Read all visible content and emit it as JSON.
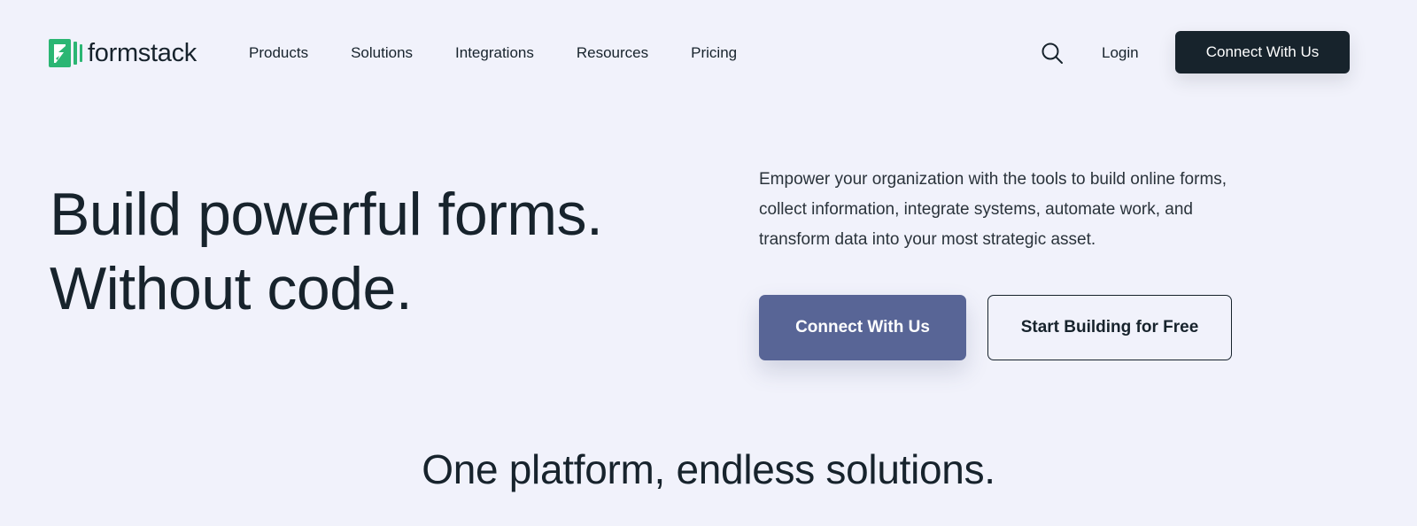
{
  "header": {
    "logo": {
      "text": "formstack",
      "icon": "formstack-logo-icon",
      "brand_color": "#2bb673"
    },
    "nav": [
      {
        "label": "Products"
      },
      {
        "label": "Solutions"
      },
      {
        "label": "Integrations"
      },
      {
        "label": "Resources"
      },
      {
        "label": "Pricing"
      }
    ],
    "search_icon": "search-icon",
    "login_label": "Login",
    "cta_label": "Connect With Us",
    "cta_color": "#17232c"
  },
  "hero": {
    "title_lines": [
      "Build powerful forms.",
      "Without code."
    ],
    "description_lines": [
      "Empower your organization with the tools to build online forms,",
      "collect information, integrate systems, automate work, and",
      "transform data into your most strategic asset."
    ],
    "primary_button": {
      "label": "Connect With Us",
      "color": "#586596"
    },
    "secondary_button": {
      "label": "Start Building for Free"
    }
  },
  "section": {
    "title": "One platform, endless solutions."
  },
  "colors": {
    "background": "#f1f2fb",
    "text": "#17232c"
  }
}
